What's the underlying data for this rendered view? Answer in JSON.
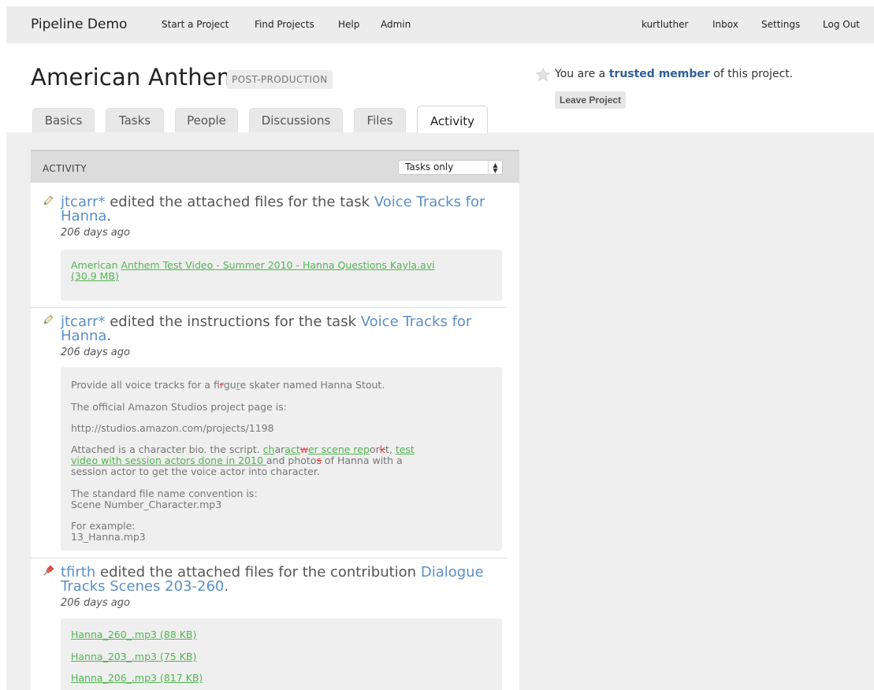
{
  "nav": {
    "brand": "Pipeline Demo",
    "left_links": [
      "Start a Project",
      "Find Projects",
      "Help",
      "Admin"
    ],
    "right_links": [
      "kurtluther",
      "Inbox",
      "Settings",
      "Log Out"
    ]
  },
  "project": {
    "title": "American Anthem",
    "stage": "POST-PRODUCTION",
    "membership": {
      "prefix": "You are a",
      "role": "trusted member",
      "suffix": "of this project."
    },
    "leave_label": "Leave Project"
  },
  "tabs": [
    {
      "label": "Basics",
      "active": false
    },
    {
      "label": "Tasks",
      "active": false
    },
    {
      "label": "People",
      "active": false
    },
    {
      "label": "Discussions",
      "active": false
    },
    {
      "label": "Files",
      "active": false
    },
    {
      "label": "Activity",
      "active": true
    }
  ],
  "activity": {
    "header": "ACTIVITY",
    "filter_value": "Tasks only",
    "items": [
      {
        "icon": "pencil-icon",
        "user": "jtcarr*",
        "action": "edited the attached files for the task",
        "target_line1": "Voice Tracks for",
        "target_line2": "Hanna",
        "time": "206 days ago",
        "file_prefix": "American",
        "file_link_line1": "Anthem Test Video - Summer 2010 - Hanna Questions Kayla.avi",
        "file_link_line2": "(30.9 MB)"
      },
      {
        "icon": "pencil-icon",
        "user": "jtcarr*",
        "action": "edited the instructions for the task",
        "target_line1": "Voice Tracks for",
        "target_line2": "Hanna",
        "time": "206 days ago",
        "lines": {
          "p1_a": "Provide all voice tracks for a fi",
          "p1_del": "r",
          "p1_b": "gu",
          "p1_ins": "r",
          "p1_c": "e skater named Hanna Stout.",
          "p2": "The official Amazon Studios project page is:",
          "p3": "http://studios.amazon.com/projects/1198",
          "p4_a": "Attached is a character bio. the script. ",
          "p4_ins1": "ch",
          "p4_b": "ar",
          "p4_ins2": "act",
          "p4_del": "w",
          "p4_ins3": "er scene rep",
          "p4_c": "or",
          "p4_del2": "k",
          "p4_d": "t, ",
          "p4_ins4": "test",
          "p4_ins5": "video with session actors done in 2010 ",
          "p4_e": "and photo",
          "p4_del3": "s",
          "p4_f": " of Hanna with a",
          "p4_g": "session actor to get the voice actor into character.",
          "p5_a": "The standard file name convention is:",
          "p5_b": "Scene Number_Character.mp3",
          "p6_a": "For example:",
          "p6_b": "13_Hanna.mp3"
        }
      },
      {
        "icon": "pushpin-icon",
        "user": "tfirth",
        "action": "edited the attached files for the contribution",
        "target_line1": "Dialogue",
        "target_line2": "Tracks Scenes 203-260",
        "time": "206 days ago",
        "files": [
          "Hanna_260_.mp3 (88 KB)",
          "Hanna_203_.mp3 (75 KB)",
          "Hanna_206_.mp3 (817 KB)"
        ]
      }
    ]
  },
  "colors": {
    "link_blue": "#5b8fc7",
    "role_blue": "#2f5f9a",
    "insert_green": "#53b453",
    "delete_red": "#e04848"
  }
}
